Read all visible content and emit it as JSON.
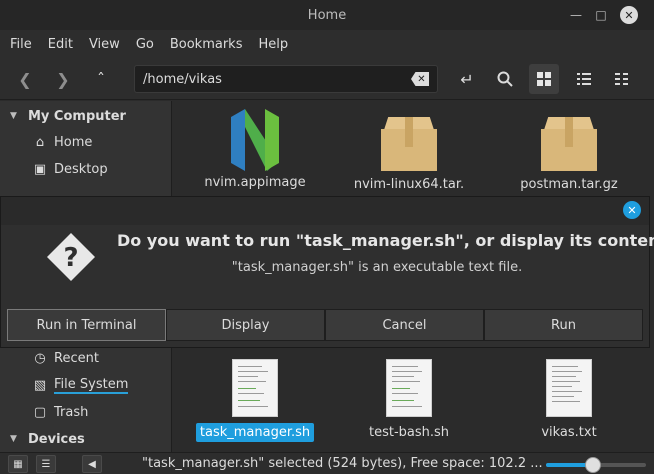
{
  "window": {
    "title": "Home"
  },
  "menubar": [
    "File",
    "Edit",
    "View",
    "Go",
    "Bookmarks",
    "Help"
  ],
  "toolbar": {
    "path": "/home/vikas"
  },
  "sidebar": {
    "my_computer": "My Computer",
    "home": "Home",
    "desktop": "Desktop",
    "recent": "Recent",
    "file_system": "File System",
    "trash": "Trash",
    "devices": "Devices"
  },
  "files_top": [
    {
      "name": "nvim.appimage",
      "icon": "neovim-logo-icon"
    },
    {
      "name": "nvim-linux64.tar.",
      "icon": "archive-box-icon"
    },
    {
      "name": "postman.tar.gz",
      "icon": "archive-box-icon"
    }
  ],
  "files_bottom": [
    {
      "name": "task_manager.sh",
      "icon": "text-document-icon",
      "selected": true
    },
    {
      "name": "test-bash.sh",
      "icon": "text-document-icon"
    },
    {
      "name": "vikas.txt",
      "icon": "text-document-icon"
    }
  ],
  "dialog": {
    "title": "Do you want to run \"task_manager.sh\", or display its contents?",
    "subtitle": "\"task_manager.sh\" is an executable text file.",
    "buttons": {
      "run_terminal": "Run in Terminal",
      "display": "Display",
      "cancel": "Cancel",
      "run": "Run"
    }
  },
  "statusbar": {
    "text": "\"task_manager.sh\" selected (524 bytes), Free space: 102.2 ...",
    "zoom_level": 0.47
  },
  "colors": {
    "accent": "#1f9ede",
    "background": "#2b2b2b",
    "sidebar": "#333333"
  }
}
